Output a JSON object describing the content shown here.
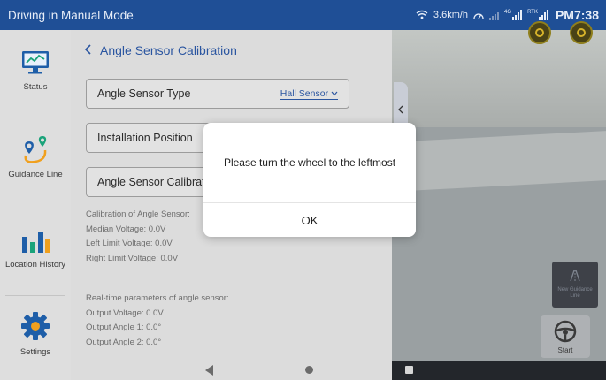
{
  "status_bar": {
    "title": "Driving in Manual Mode",
    "speed": "3.6km/h",
    "signal1_label": "4G",
    "signal2_label": "RTK",
    "time": "PM7:38"
  },
  "sidebar": {
    "items": [
      {
        "label": "Status",
        "icon": "monitor-chart-icon"
      },
      {
        "label": "Guidance Line",
        "icon": "route-pins-icon"
      },
      {
        "label": "Location History",
        "icon": "bar-chart-icon"
      },
      {
        "label": "Settings",
        "icon": "gear-icon"
      }
    ]
  },
  "panel": {
    "title": "Angle Sensor Calibration",
    "fields": [
      {
        "label": "Angle Sensor Type",
        "value": "Hall Sensor"
      },
      {
        "label": "Installation Position",
        "value": ""
      },
      {
        "label": "Angle Sensor Calibration",
        "value": ""
      }
    ],
    "calibration": {
      "heading": "Calibration of Angle Sensor:",
      "median": "Median Voltage: 0.0V",
      "left": "Left Limit Voltage: 0.0V",
      "right": "Right Limit Voltage: 0.0V"
    },
    "realtime": {
      "heading": "Real-time parameters of angle sensor:",
      "voltage": "Output Voltage: 0.0V",
      "angle1": "Output Angle 1: 0.0°",
      "angle2": "Output Angle 2: 0.0°"
    }
  },
  "map": {
    "new_guidance_line": "New Guidance Line",
    "start": "Start"
  },
  "dialog": {
    "message": "Please turn the wheel to the leftmost",
    "ok": "OK"
  },
  "colors": {
    "status_bar": "#1f4f96",
    "accent": "#2a55a0",
    "icon_blue": "#1e5ea8",
    "icon_teal": "#1aa37a",
    "icon_orange": "#f0a01e"
  }
}
